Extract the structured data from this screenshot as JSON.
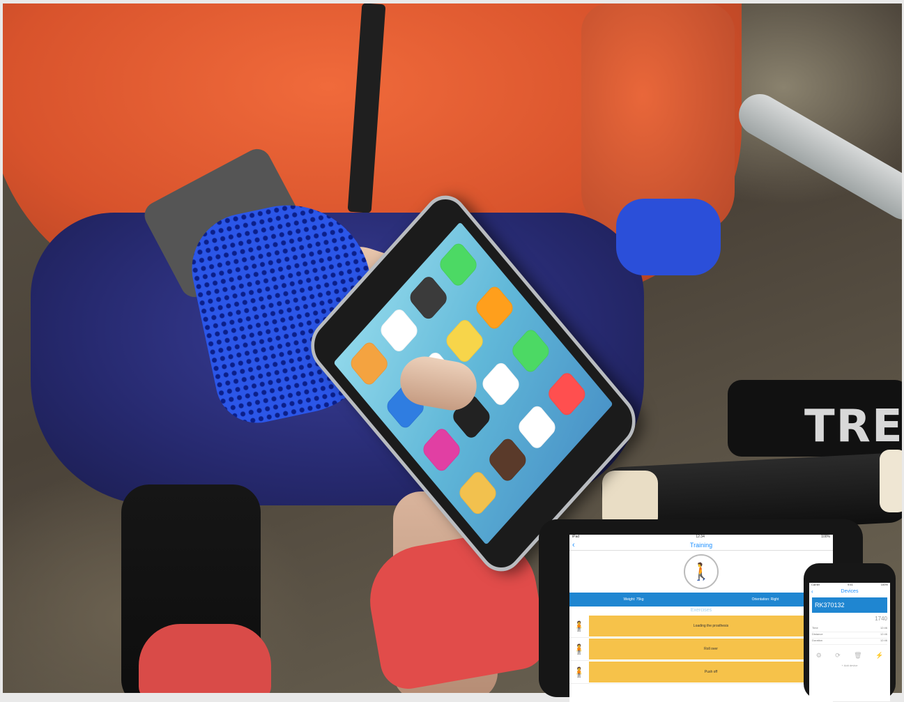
{
  "scene": {
    "description_tag": "photo",
    "jacket_color": "#e05a30",
    "glove_color": "#2b56e8",
    "bike_text": "TRE"
  },
  "tablet": {
    "status_left": "iPad",
    "status_center": "12:34",
    "status_right": "100%",
    "title": "Training",
    "weight_label": "Weight: 75kg",
    "orientation_label": "Orientation: Right",
    "section_label": "Exercises",
    "exercises": [
      {
        "label": "Loading the prosthesis",
        "icon": "person-icon"
      },
      {
        "label": "Roll over",
        "icon": "person-icon"
      },
      {
        "label": "Push off",
        "icon": "person-icon"
      }
    ],
    "accent": "#1f86d1",
    "row_color": "#f6c24a"
  },
  "small_phone": {
    "status_left": "Carrier",
    "status_center": "9:41",
    "status_right": "100%",
    "title": "Devices",
    "device_name": "RK370132",
    "value": "1740",
    "list": [
      {
        "label": "Time",
        "value": "12:46"
      },
      {
        "label": "Distance",
        "value": "12:46"
      },
      {
        "label": "Duration",
        "value": "12:46"
      }
    ],
    "add_label": "+ Add device"
  }
}
